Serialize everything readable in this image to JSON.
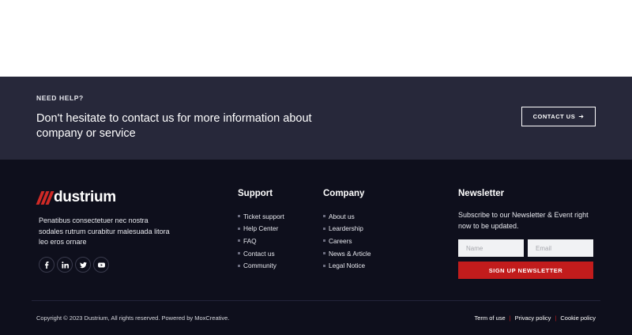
{
  "help": {
    "eyebrow": "NEED HELP?",
    "heading": "Don't hesitate to contact us for more information about company or service",
    "contact_label": "CONTACT US",
    "contact_arrow": "➜"
  },
  "brand": {
    "name": "dustrium",
    "about": "Penatibus consectetuer nec nostra sodales rutrum curabitur malesuada litora leo eros ornare",
    "socials": [
      "facebook-icon",
      "linkedin-icon",
      "twitter-icon",
      "youtube-icon"
    ],
    "accent_color": "#cf2a26"
  },
  "support": {
    "title": "Support",
    "links": [
      "Ticket support",
      "Help Center",
      "FAQ",
      "Contact us",
      "Community"
    ]
  },
  "company": {
    "title": "Company",
    "links": [
      "About us",
      "Leardership",
      "Careers",
      "News & Article",
      "Legal Notice"
    ]
  },
  "newsletter": {
    "title": "Newsletter",
    "text": "Subscribe to our Newsletter & Event right now to be updated.",
    "name_placeholder": "Name",
    "email_placeholder": "Email",
    "button_label": "SIGN UP NEWSLETTER",
    "button_color": "#c21c1c"
  },
  "bottom": {
    "copyright": "Copyright © 2023 Dustrium, All rights reserved. Powered by MoxCreative.",
    "links": [
      "Term of use",
      "Privacy policy",
      "Cookie policy"
    ]
  },
  "colors": {
    "help_band": "#27283a",
    "footer_bg": "#0e0f1c"
  }
}
